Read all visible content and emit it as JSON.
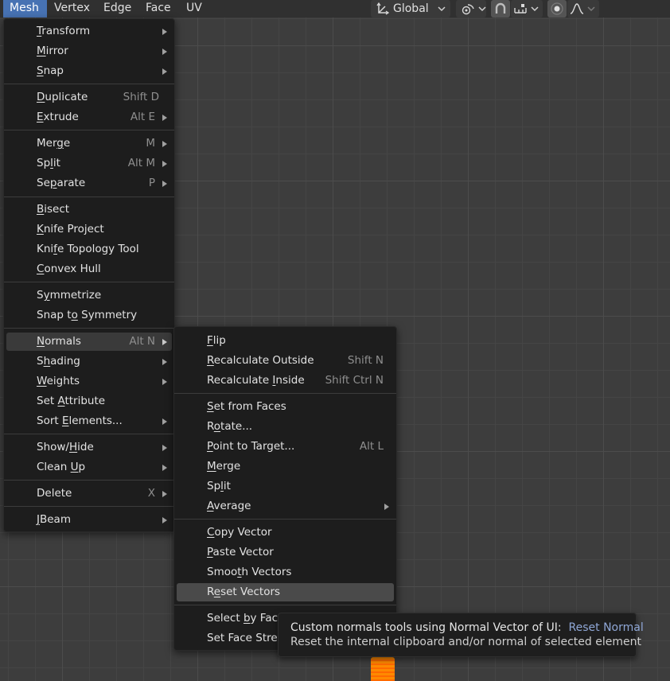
{
  "header": {
    "menus": [
      "Mesh",
      "Vertex",
      "Edge",
      "Face",
      "UV"
    ],
    "transform_orientation": "Global",
    "icons": {
      "orientation": "transform-orientation-icon",
      "pivot": "pivot-point-icon",
      "snap": "snap-magnet-icon",
      "snap_target": "snap-increment-icon",
      "proportional": "proportional-editing-icon",
      "falloff": "falloff-curve-icon"
    }
  },
  "mesh_menu": {
    "items": [
      {
        "label": "Transform",
        "u": "T",
        "shortcut": "",
        "submenu": true
      },
      {
        "label": "Mirror",
        "u": "M",
        "shortcut": "",
        "submenu": true
      },
      {
        "label": "Snap",
        "u": "S",
        "shortcut": "",
        "submenu": true
      },
      {
        "label": "Duplicate",
        "u": "D",
        "shortcut": "Shift D",
        "submenu": false
      },
      {
        "label": "Extrude",
        "u": "E",
        "shortcut": "Alt E",
        "submenu": true
      },
      {
        "label": "Merge",
        "u": "g",
        "shortcut": "M",
        "submenu": true
      },
      {
        "label": "Split",
        "u": "l",
        "shortcut": "Alt M",
        "submenu": true
      },
      {
        "label": "Separate",
        "u": "p",
        "shortcut": "P",
        "submenu": true
      },
      {
        "label": "Bisect",
        "u": "B",
        "shortcut": "",
        "submenu": false
      },
      {
        "label": "Knife Project",
        "u": "K",
        "shortcut": "",
        "submenu": false
      },
      {
        "label": "Knife Topology Tool",
        "u": "f",
        "shortcut": "",
        "submenu": false
      },
      {
        "label": "Convex Hull",
        "u": "C",
        "shortcut": "",
        "submenu": false
      },
      {
        "label": "Symmetrize",
        "u": "y",
        "shortcut": "",
        "submenu": false
      },
      {
        "label": "Snap to Symmetry",
        "u": "o",
        "shortcut": "",
        "submenu": false
      },
      {
        "label": "Normals",
        "u": "N",
        "shortcut": "Alt N",
        "submenu": true
      },
      {
        "label": "Shading",
        "u": "h",
        "shortcut": "",
        "submenu": true
      },
      {
        "label": "Weights",
        "u": "W",
        "shortcut": "",
        "submenu": true
      },
      {
        "label": "Set Attribute",
        "u": "A",
        "shortcut": "",
        "submenu": false
      },
      {
        "label": "Sort Elements...",
        "u": "E",
        "shortcut": "",
        "submenu": true
      },
      {
        "label": "Show/Hide",
        "u": "H",
        "shortcut": "",
        "submenu": true
      },
      {
        "label": "Clean Up",
        "u": "U",
        "shortcut": "",
        "submenu": true
      },
      {
        "label": "Delete",
        "u": "",
        "shortcut": "X",
        "submenu": true
      },
      {
        "label": "JBeam",
        "u": "J",
        "shortcut": "",
        "submenu": true
      }
    ]
  },
  "normals_menu": {
    "items": [
      {
        "label": "Flip",
        "u": "F",
        "shortcut": "",
        "submenu": false
      },
      {
        "label": "Recalculate Outside",
        "u": "R",
        "shortcut": "Shift N",
        "submenu": false
      },
      {
        "label": "Recalculate Inside",
        "u": "I",
        "shortcut": "Shift Ctrl N",
        "submenu": false
      },
      {
        "label": "Set from Faces",
        "u": "S",
        "shortcut": "",
        "submenu": false
      },
      {
        "label": "Rotate...",
        "u": "o",
        "shortcut": "",
        "submenu": false
      },
      {
        "label": "Point to Target...",
        "u": "P",
        "shortcut": "Alt L",
        "submenu": false
      },
      {
        "label": "Merge",
        "u": "M",
        "shortcut": "",
        "submenu": false
      },
      {
        "label": "Split",
        "u": "l",
        "shortcut": "",
        "submenu": false
      },
      {
        "label": "Average",
        "u": "A",
        "shortcut": "",
        "submenu": true
      },
      {
        "label": "Copy Vector",
        "u": "C",
        "shortcut": "",
        "submenu": false
      },
      {
        "label": "Paste Vector",
        "u": "P",
        "shortcut": "",
        "submenu": false
      },
      {
        "label": "Smooth Vectors",
        "u": "t",
        "shortcut": "",
        "submenu": false
      },
      {
        "label": "Reset Vectors",
        "u": "e",
        "shortcut": "",
        "submenu": false
      },
      {
        "label": "Select by Face Strength",
        "u": "b",
        "shortcut": "",
        "submenu": false
      },
      {
        "label": "Set Face Strength",
        "u": "",
        "shortcut": "",
        "submenu": false
      }
    ]
  },
  "tooltip": {
    "line1_prefix": "Custom normals tools using Normal Vector of UI:",
    "line1_value": "Reset Normal",
    "line2": "Reset the internal clipboard and/or normal of selected element"
  },
  "colors": {
    "accent": "#4772b3",
    "menu_bg": "#1d1d1d",
    "viewport_bg": "#3d3d3d",
    "tooltip_accent": "#8fa7d6",
    "object_orange": "#ff8a00"
  }
}
